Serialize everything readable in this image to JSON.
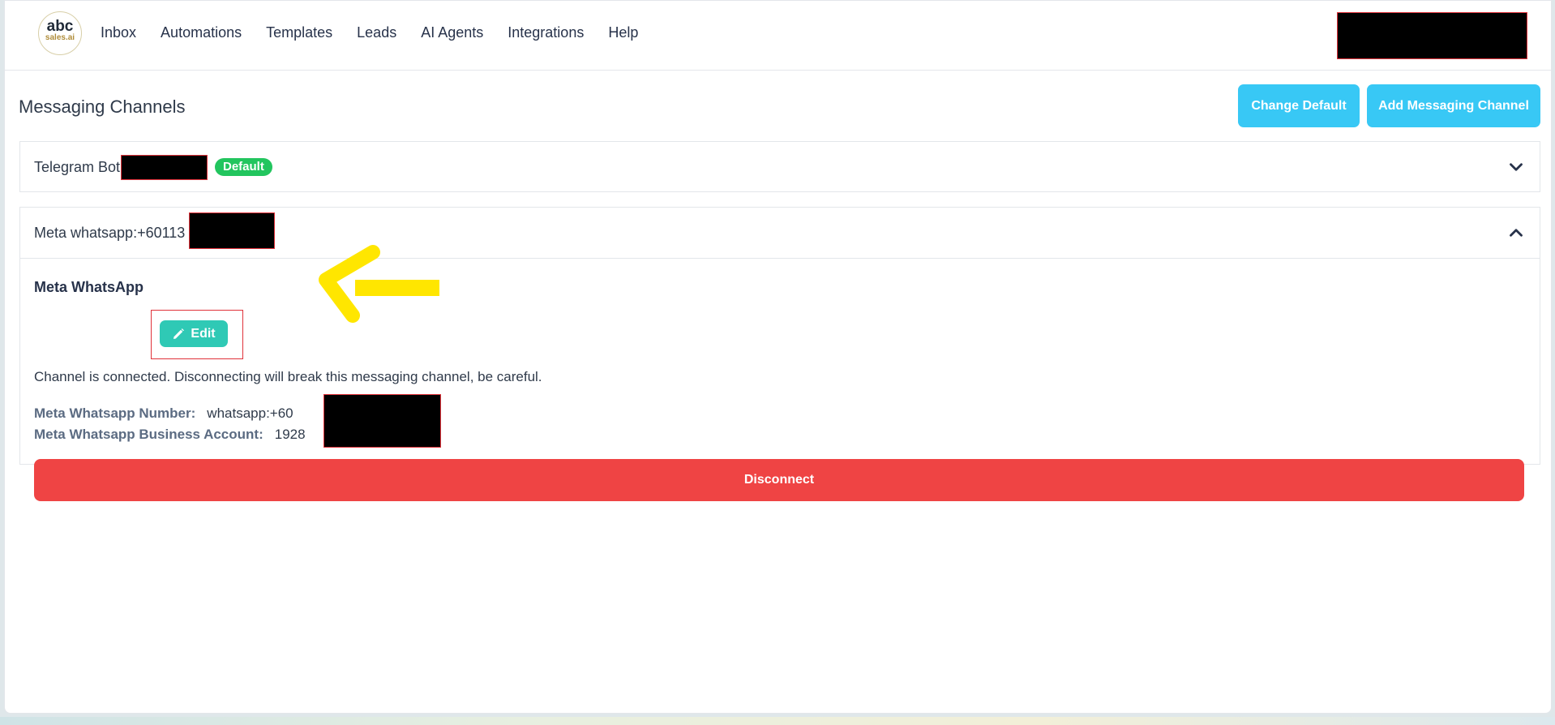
{
  "logo": {
    "line1": "abc",
    "line2": "sales.ai"
  },
  "nav": {
    "items": [
      "Inbox",
      "Automations",
      "Templates",
      "Leads",
      "AI Agents",
      "Integrations",
      "Help"
    ]
  },
  "page": {
    "title": "Messaging Channels",
    "change_default_label": "Change Default",
    "add_channel_label": "Add Messaging Channel"
  },
  "channels": [
    {
      "title": "Telegram Bot",
      "badge": "Default",
      "expanded": false,
      "chevron_icon": "chevron-down-icon"
    },
    {
      "title": "Meta whatsapp:+60113",
      "expanded": true,
      "chevron_icon": "chevron-up-icon",
      "section_title": "Meta WhatsApp",
      "edit_label": "Edit",
      "edit_icon": "pencil-icon",
      "notice": "Channel is connected. Disconnecting will break this messaging channel, be careful.",
      "number_label": "Meta Whatsapp Number:",
      "number_value": "whatsapp:+60",
      "business_label": "Meta Whatsapp Business Account:",
      "business_value": "1928",
      "disconnect_label": "Disconnect"
    }
  ],
  "colors": {
    "primary_button": "#38c8f5",
    "edit_button": "#2fc9b5",
    "danger": "#ef4444",
    "badge_default": "#22c55e",
    "annotation_arrow": "#ffe600"
  }
}
